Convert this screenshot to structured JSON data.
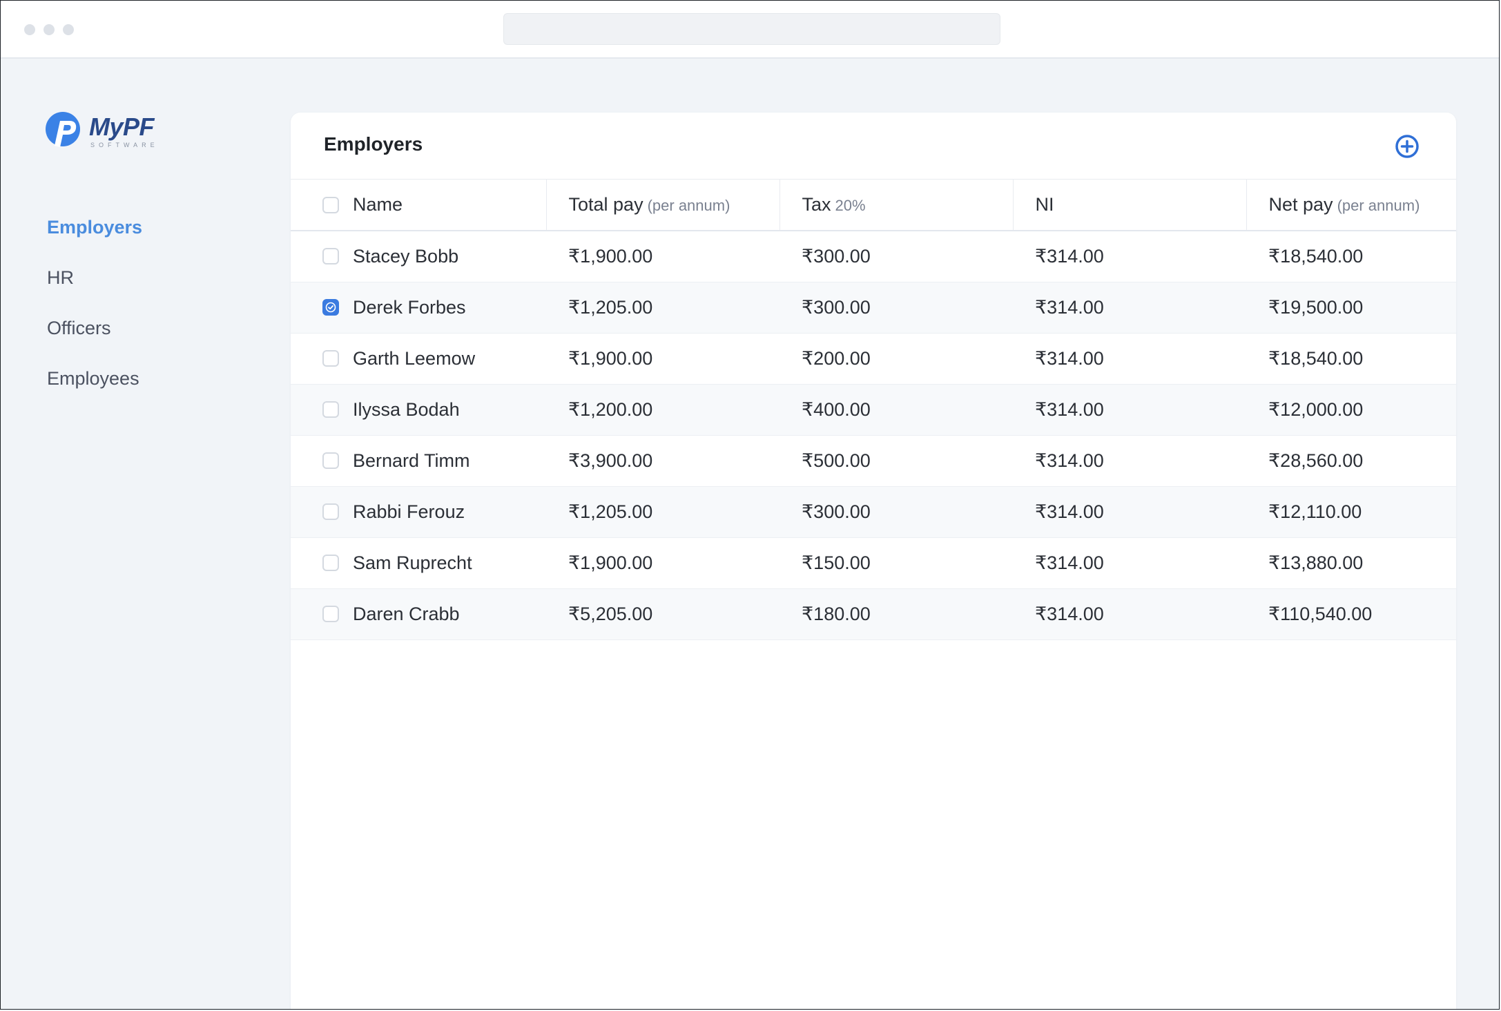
{
  "sidebar": {
    "logo": {
      "word": "MyPF",
      "sub": "SOFTWARE"
    },
    "items": [
      {
        "label": "Employers",
        "active": true
      },
      {
        "label": "HR",
        "active": false
      },
      {
        "label": "Officers",
        "active": false
      },
      {
        "label": "Employees",
        "active": false
      }
    ]
  },
  "card": {
    "title": "Employers",
    "add_icon": "plus-circle-icon"
  },
  "table": {
    "columns": [
      {
        "label": "Name",
        "sub": ""
      },
      {
        "label": "Total pay",
        "sub": "(per annum)"
      },
      {
        "label": "Tax",
        "sub": "20%"
      },
      {
        "label": "NI",
        "sub": ""
      },
      {
        "label": "Net pay",
        "sub": "(per annum)"
      }
    ],
    "rows": [
      {
        "checked": false,
        "name": "Stacey Bobb",
        "total": "₹1,900.00",
        "tax": "₹300.00",
        "ni": "₹314.00",
        "net": "₹18,540.00"
      },
      {
        "checked": true,
        "name": "Derek Forbes",
        "total": "₹1,205.00",
        "tax": "₹300.00",
        "ni": "₹314.00",
        "net": "₹19,500.00"
      },
      {
        "checked": false,
        "name": "Garth Leemow",
        "total": "₹1,900.00",
        "tax": "₹200.00",
        "ni": "₹314.00",
        "net": "₹18,540.00"
      },
      {
        "checked": false,
        "name": "Ilyssa Bodah",
        "total": "₹1,200.00",
        "tax": "₹400.00",
        "ni": "₹314.00",
        "net": "₹12,000.00"
      },
      {
        "checked": false,
        "name": "Bernard Timm",
        "total": "₹3,900.00",
        "tax": "₹500.00",
        "ni": "₹314.00",
        "net": "₹28,560.00"
      },
      {
        "checked": false,
        "name": "Rabbi Ferouz",
        "total": "₹1,205.00",
        "tax": "₹300.00",
        "ni": "₹314.00",
        "net": "₹12,110.00"
      },
      {
        "checked": false,
        "name": "Sam Ruprecht",
        "total": "₹1,900.00",
        "tax": "₹150.00",
        "ni": "₹314.00",
        "net": "₹13,880.00"
      },
      {
        "checked": false,
        "name": "Daren Crabb",
        "total": "₹5,205.00",
        "tax": "₹180.00",
        "ni": "₹314.00",
        "net": "₹110,540.00"
      }
    ]
  },
  "colors": {
    "accent": "#3b7be0",
    "nav_active": "#4a8cde",
    "logo_blue": "#2a4a8a"
  }
}
